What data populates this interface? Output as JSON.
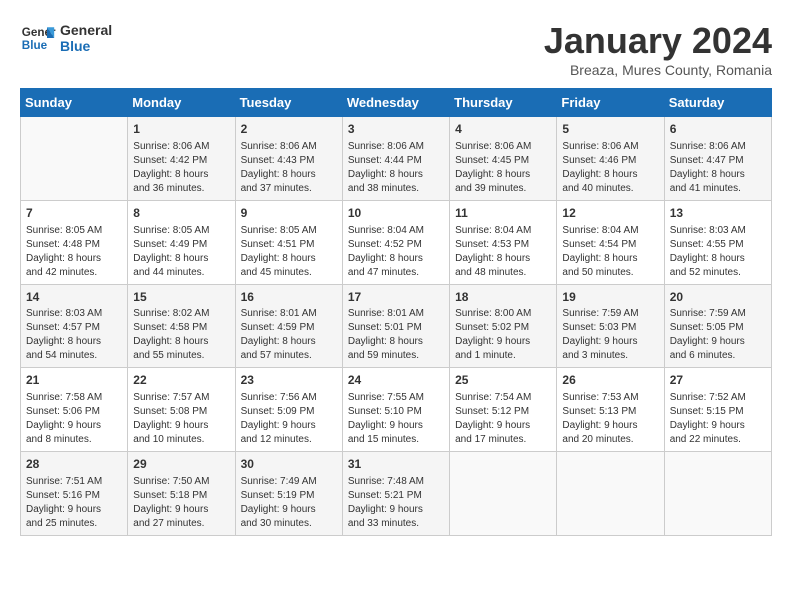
{
  "header": {
    "logo_line1": "General",
    "logo_line2": "Blue",
    "month": "January 2024",
    "location": "Breaza, Mures County, Romania"
  },
  "days_of_week": [
    "Sunday",
    "Monday",
    "Tuesday",
    "Wednesday",
    "Thursday",
    "Friday",
    "Saturday"
  ],
  "weeks": [
    [
      {
        "day": "",
        "content": ""
      },
      {
        "day": "1",
        "content": "Sunrise: 8:06 AM\nSunset: 4:42 PM\nDaylight: 8 hours\nand 36 minutes."
      },
      {
        "day": "2",
        "content": "Sunrise: 8:06 AM\nSunset: 4:43 PM\nDaylight: 8 hours\nand 37 minutes."
      },
      {
        "day": "3",
        "content": "Sunrise: 8:06 AM\nSunset: 4:44 PM\nDaylight: 8 hours\nand 38 minutes."
      },
      {
        "day": "4",
        "content": "Sunrise: 8:06 AM\nSunset: 4:45 PM\nDaylight: 8 hours\nand 39 minutes."
      },
      {
        "day": "5",
        "content": "Sunrise: 8:06 AM\nSunset: 4:46 PM\nDaylight: 8 hours\nand 40 minutes."
      },
      {
        "day": "6",
        "content": "Sunrise: 8:06 AM\nSunset: 4:47 PM\nDaylight: 8 hours\nand 41 minutes."
      }
    ],
    [
      {
        "day": "7",
        "content": "Sunrise: 8:05 AM\nSunset: 4:48 PM\nDaylight: 8 hours\nand 42 minutes."
      },
      {
        "day": "8",
        "content": "Sunrise: 8:05 AM\nSunset: 4:49 PM\nDaylight: 8 hours\nand 44 minutes."
      },
      {
        "day": "9",
        "content": "Sunrise: 8:05 AM\nSunset: 4:51 PM\nDaylight: 8 hours\nand 45 minutes."
      },
      {
        "day": "10",
        "content": "Sunrise: 8:04 AM\nSunset: 4:52 PM\nDaylight: 8 hours\nand 47 minutes."
      },
      {
        "day": "11",
        "content": "Sunrise: 8:04 AM\nSunset: 4:53 PM\nDaylight: 8 hours\nand 48 minutes."
      },
      {
        "day": "12",
        "content": "Sunrise: 8:04 AM\nSunset: 4:54 PM\nDaylight: 8 hours\nand 50 minutes."
      },
      {
        "day": "13",
        "content": "Sunrise: 8:03 AM\nSunset: 4:55 PM\nDaylight: 8 hours\nand 52 minutes."
      }
    ],
    [
      {
        "day": "14",
        "content": "Sunrise: 8:03 AM\nSunset: 4:57 PM\nDaylight: 8 hours\nand 54 minutes."
      },
      {
        "day": "15",
        "content": "Sunrise: 8:02 AM\nSunset: 4:58 PM\nDaylight: 8 hours\nand 55 minutes."
      },
      {
        "day": "16",
        "content": "Sunrise: 8:01 AM\nSunset: 4:59 PM\nDaylight: 8 hours\nand 57 minutes."
      },
      {
        "day": "17",
        "content": "Sunrise: 8:01 AM\nSunset: 5:01 PM\nDaylight: 8 hours\nand 59 minutes."
      },
      {
        "day": "18",
        "content": "Sunrise: 8:00 AM\nSunset: 5:02 PM\nDaylight: 9 hours\nand 1 minute."
      },
      {
        "day": "19",
        "content": "Sunrise: 7:59 AM\nSunset: 5:03 PM\nDaylight: 9 hours\nand 3 minutes."
      },
      {
        "day": "20",
        "content": "Sunrise: 7:59 AM\nSunset: 5:05 PM\nDaylight: 9 hours\nand 6 minutes."
      }
    ],
    [
      {
        "day": "21",
        "content": "Sunrise: 7:58 AM\nSunset: 5:06 PM\nDaylight: 9 hours\nand 8 minutes."
      },
      {
        "day": "22",
        "content": "Sunrise: 7:57 AM\nSunset: 5:08 PM\nDaylight: 9 hours\nand 10 minutes."
      },
      {
        "day": "23",
        "content": "Sunrise: 7:56 AM\nSunset: 5:09 PM\nDaylight: 9 hours\nand 12 minutes."
      },
      {
        "day": "24",
        "content": "Sunrise: 7:55 AM\nSunset: 5:10 PM\nDaylight: 9 hours\nand 15 minutes."
      },
      {
        "day": "25",
        "content": "Sunrise: 7:54 AM\nSunset: 5:12 PM\nDaylight: 9 hours\nand 17 minutes."
      },
      {
        "day": "26",
        "content": "Sunrise: 7:53 AM\nSunset: 5:13 PM\nDaylight: 9 hours\nand 20 minutes."
      },
      {
        "day": "27",
        "content": "Sunrise: 7:52 AM\nSunset: 5:15 PM\nDaylight: 9 hours\nand 22 minutes."
      }
    ],
    [
      {
        "day": "28",
        "content": "Sunrise: 7:51 AM\nSunset: 5:16 PM\nDaylight: 9 hours\nand 25 minutes."
      },
      {
        "day": "29",
        "content": "Sunrise: 7:50 AM\nSunset: 5:18 PM\nDaylight: 9 hours\nand 27 minutes."
      },
      {
        "day": "30",
        "content": "Sunrise: 7:49 AM\nSunset: 5:19 PM\nDaylight: 9 hours\nand 30 minutes."
      },
      {
        "day": "31",
        "content": "Sunrise: 7:48 AM\nSunset: 5:21 PM\nDaylight: 9 hours\nand 33 minutes."
      },
      {
        "day": "",
        "content": ""
      },
      {
        "day": "",
        "content": ""
      },
      {
        "day": "",
        "content": ""
      }
    ]
  ]
}
